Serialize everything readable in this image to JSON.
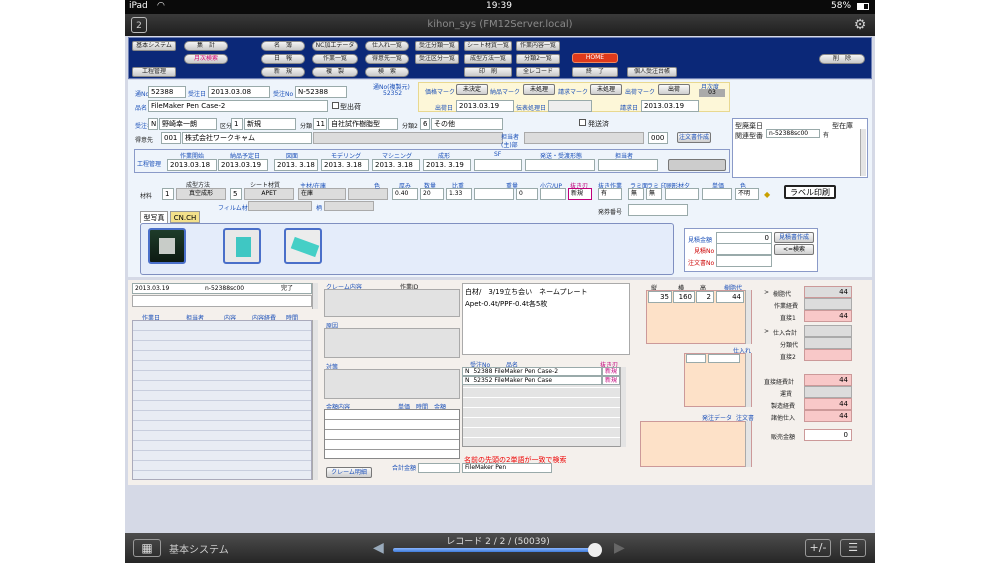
{
  "status_bar": {
    "device": "iPad",
    "time": "19:39",
    "battery": "58%"
  },
  "title_bar": {
    "title": "kihon_sys (FM12Server.local)"
  },
  "nav": {
    "system": "基本システム",
    "shukei": "集　計",
    "monthly_search": "月次検索",
    "process_mgmt": "工程管理",
    "meibo": "名　簿",
    "nippo": "日　報",
    "shinki": "新　規",
    "nc": "NC加工データ",
    "sagyo_list": "作業一覧",
    "fukusei": "複　製",
    "shiire_list": "仕入れ一覧",
    "tokui_list": "得意先一覧",
    "kensaku": "検　索",
    "juchu_bunrui": "受注分類一覧",
    "juchu_kubun": "受注区分一覧",
    "sheet_list": "シート材質一覧",
    "seikei_list": "成型方法一覧",
    "insatsu": "印　刷",
    "sagyo_naiyo": "作業内容一覧",
    "bunrui2": "分類2一覧",
    "all_records": "全レコード",
    "home": "HOME",
    "owari": "終　了",
    "kojin": "個人受注台帳",
    "delete": "削　除"
  },
  "order": {
    "no_label": "通No",
    "no": "52388",
    "date_label": "受注日",
    "date": "2013.03.08",
    "juchu_no_label": "受注No",
    "juchu_no": "N-52388",
    "ref_label": "通No(複製元)",
    "ref": "52352",
    "hinmei_label": "品名",
    "hinmei": "FileMaker Pen Case-2",
    "kata_label": "型出荷",
    "kakaku_label": "価格マーク",
    "kakaku": "未決定",
    "nohin_label": "納品マーク",
    "nohin": "未処理",
    "seikyu_label": "請求マーク",
    "seikyu": "未処理",
    "shukka_label": "出荷マーク",
    "shukka": "出荷",
    "getsuji_label": "月次度",
    "getsuji": "03",
    "shukka_date_label": "出荷日",
    "shukka_date": "2013.03.19",
    "denpyo_label": "伝表処理日",
    "seikyu_date_label": "請求日",
    "seikyu_date": "2013.03.19",
    "hasso_label": "発送済",
    "tantosha_label": "受注者",
    "tantosha_code": "N",
    "tantosha": "野崎幸一朗",
    "kubun_label": "区分",
    "kubun_code": "1",
    "kubun": "新規",
    "bunrui_label": "分類",
    "bunrui_code": "11",
    "bunrui": "自社試作樹脂型",
    "bunrui2_label": "分類2",
    "bunrui2_code": "6",
    "bunrui2": "その他",
    "tokui_label": "得意先",
    "tokui_code": "001",
    "tokui": "株式会社ワークキャム",
    "tanto_label": "担当者",
    "sakusei_label": "(主)部",
    "tokui_no": "000",
    "chumon_btn": "注文書作成"
  },
  "katakanri": {
    "title": "型廃棄日",
    "shiryo": "型在庫",
    "kanren_label": "関連型番",
    "kanren": "n-52388sc00",
    "kanren_val": "有"
  },
  "process": {
    "section": "工程管理",
    "sagyo_kaishi_label": "作業開始",
    "sagyo_kaishi": "2013.03.18",
    "nohin_yotei_label": "納品予定日",
    "nohin_yotei": "2013.03.19",
    "zumen_label": "図面",
    "zumen": "2013. 3.18",
    "modeling_label": "モデリング",
    "modeling": "2013. 3.18",
    "machining_label": "マシニング",
    "machining": "2013. 3.18",
    "seikei_label": "成形",
    "seikei": "2013. 3.19",
    "sf_label": "SF",
    "hasso_label": "発送・受渡形態",
    "tanto_label": "担当者"
  },
  "material": {
    "seikei_label": "成型方法",
    "sheet_label": "シート材質",
    "zairyo_label": "材料",
    "zairyo_qty": "1",
    "seikei": "真空成形",
    "sheet_code": "5",
    "sheet": "APET",
    "zairyo_label2": "主材/在庫",
    "zaiko": "在庫",
    "atsu_label": "厚み",
    "atsu": "0.40",
    "suryo_label": "数量",
    "suryo": "20",
    "hiju_label": "比重",
    "hiju": "1.33",
    "jyuryo_label": "重量",
    "jyuryo": "0",
    "dakoku_label": "小穴/UP",
    "nukigata_label": "抜き刃",
    "nukigata": "新規",
    "nukisagyo_label": "抜き作業",
    "nukisagyo": "有",
    "lami_label": "ラミ面",
    "lami": "無",
    "lami_insatsu_label": "ラミ 印刷",
    "lami_insatsu": "無",
    "keijou_label": "形材夕",
    "tanka_label": "単価",
    "iro_label": "色",
    "iro": "不明",
    "film_label": "フィルム材質",
    "film2_label": "柄",
    "label_btn": "ラベル印刷",
    "hacchu_label": "発券番号"
  },
  "photos": {
    "tab1": "型写真",
    "tab2": "CN.CH"
  },
  "estimate": {
    "mitsumori_label": "見積金額",
    "mitsumori": "0",
    "mitsumori_btn": "見積書作成",
    "mitsumori_no_label": "見積No",
    "chumon_no_label": "注文書No",
    "search_btn": "<=検索"
  },
  "log": {
    "date": "2013.03.19",
    "code": "n-52388sc00",
    "status": "完了",
    "cols": [
      "作業日",
      "担当者",
      "内容",
      "内容経費",
      "時間"
    ]
  },
  "claim": {
    "naiyo_label": "クレーム内容",
    "sagyo_id_label": "作業ID",
    "gen_in_label": "原因",
    "taisaku_label": "対策",
    "kingaku_label": "金額内容",
    "tanka_label": "単価",
    "jikan_label": "時間",
    "gaku_label": "金額",
    "meisai_btn": "クレーム明細",
    "gokei_label": "合計金額"
  },
  "memo": {
    "line1": "白材/　3/19立ち会い　ネームプレート",
    "line2": "Apet-0.4t/PPF-0.4t各5枚"
  },
  "related": {
    "cols": [
      "受注No",
      "品名",
      "抜き刃"
    ],
    "rows": [
      {
        "code": "N",
        "no": "52388",
        "name": "FileMaker Pen Case-2",
        "blade": "新規"
      },
      {
        "code": "N",
        "no": "52352",
        "name": "FileMaker Pen Case",
        "blade": "新規"
      }
    ],
    "search_note": "名前の先頭の2単語が一致で検索",
    "search_value": "FileMaker Pen"
  },
  "dims": {
    "cols": [
      "縦",
      "横",
      "高",
      "樹脂代"
    ],
    "values": [
      "35",
      "160",
      "2",
      "44"
    ],
    "shiire_btn": "仕入れ",
    "hacchu_label": "発注データ",
    "chumon_btn": "注文書"
  },
  "costs": {
    "jushi_label": "樹脂代",
    "jushi": "44",
    "sagyo_label": "作業経費",
    "choku1_label": "直接1",
    "choku1": "44",
    "shiire_label": "仕入合計",
    "bunrui_label": "分類代",
    "choku2_label": "直接2",
    "chokusetsu_label": "直接経費計",
    "chokusetsu": "44",
    "unchin_label": "運賃",
    "seizo_label": "製造経費",
    "seizo": "44",
    "shoko_label": "諸他仕入",
    "shoko": "44",
    "hanbai_label": "販売金額",
    "hanbai": "0"
  },
  "toolbar": {
    "layout": "基本システム",
    "record": "レコード 2 / 2 / (50039)"
  }
}
